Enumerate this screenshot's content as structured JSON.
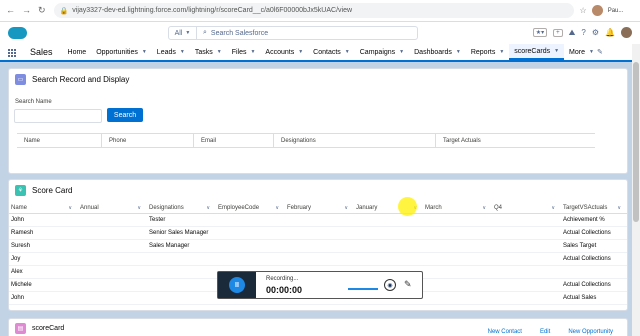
{
  "browser": {
    "url": "vijay3327-dev-ed.lightning.force.com/lightning/r/scoreCard__c/a0l6F00000bJx5kUAC/view",
    "profile_name": "Pau..."
  },
  "header": {
    "search_scope": "All",
    "search_placeholder": "Search Salesforce",
    "add_label": "+"
  },
  "nav": {
    "app_name": "Sales",
    "items": [
      {
        "label": "Home",
        "dropdown": false
      },
      {
        "label": "Opportunities",
        "dropdown": true
      },
      {
        "label": "Leads",
        "dropdown": true
      },
      {
        "label": "Tasks",
        "dropdown": true
      },
      {
        "label": "Files",
        "dropdown": true
      },
      {
        "label": "Accounts",
        "dropdown": true
      },
      {
        "label": "Contacts",
        "dropdown": true
      },
      {
        "label": "Campaigns",
        "dropdown": true
      },
      {
        "label": "Dashboards",
        "dropdown": true
      },
      {
        "label": "Reports",
        "dropdown": true
      },
      {
        "label": "scoreCards",
        "dropdown": true,
        "active": true
      },
      {
        "label": "More",
        "dropdown": true
      }
    ]
  },
  "search_card": {
    "title": "Search Record and Display",
    "search_label": "Search Name",
    "search_button": "Search",
    "columns": [
      "Name",
      "Phone",
      "Email",
      "Designations",
      "Target Actuals"
    ]
  },
  "score_card": {
    "title": "Score Card",
    "columns": [
      "Name",
      "Annual",
      "Designations",
      "EmployeeCode",
      "February",
      "January",
      "March",
      "Q4",
      "TargetVSActuals"
    ],
    "rows": [
      {
        "name": "John",
        "designation": "Tester",
        "target": "Achievement %"
      },
      {
        "name": "Ramesh",
        "designation": "Senior Sales Manager",
        "target": "Actual Collections"
      },
      {
        "name": "Suresh",
        "designation": "Sales Manager",
        "target": "Sales Target"
      },
      {
        "name": "Joy",
        "designation": "",
        "target": "Actual Collections"
      },
      {
        "name": "Alex",
        "designation": "",
        "target": ""
      },
      {
        "name": "Michele",
        "designation": "",
        "target": "Actual Collections"
      },
      {
        "name": "John",
        "designation": "",
        "target": "Actual Sales"
      }
    ]
  },
  "recorder": {
    "status": "Recording...",
    "time": "00:00:00"
  },
  "bottom_card": {
    "title": "scoreCard",
    "buttons": [
      "New Contact",
      "Edit",
      "New Opportunity"
    ]
  },
  "colors": {
    "brand": "#0070d2",
    "page_bg": "#c3d3e6"
  }
}
